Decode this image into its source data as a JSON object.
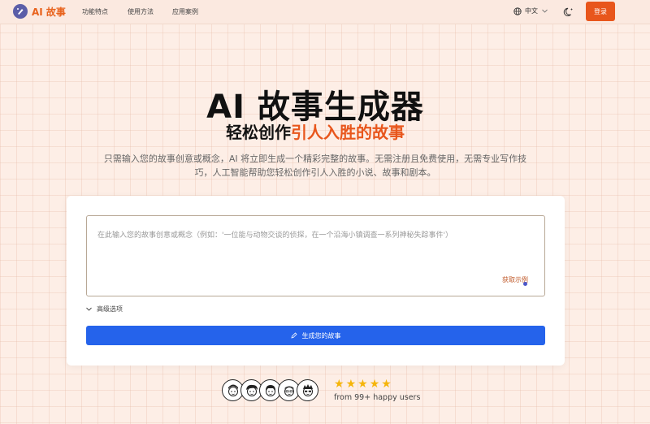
{
  "nav": {
    "logo_text": "AI 故事",
    "links": [
      "功能特点",
      "使用方法",
      "应用案例"
    ],
    "language": "中文",
    "login_label": "登录"
  },
  "hero": {
    "title": "AI 故事生成器",
    "subtitle_plain": "轻松创作",
    "subtitle_highlight": "引人入胜的故事",
    "description": "只需输入您的故事创意或概念，AI 将立即生成一个精彩完整的故事。无需注册且免费使用，无需专业写作技巧，人工智能帮助您轻松创作引人入胜的小说、故事和剧本。"
  },
  "form": {
    "textarea_placeholder": "在此输入您的故事创意或概念（例如：'一位能与动物交谈的侦探，在一个沿海小镇调查一系列神秘失踪事件'）",
    "example_link": "获取示例",
    "advanced_label": "高级选项",
    "generate_label": "生成您的故事"
  },
  "social_proof": {
    "rating_stars": 5,
    "text": "from 99+ happy users"
  },
  "colors": {
    "accent": "#e8561c",
    "button_blue": "#2563eb",
    "star": "#f5b50a"
  }
}
